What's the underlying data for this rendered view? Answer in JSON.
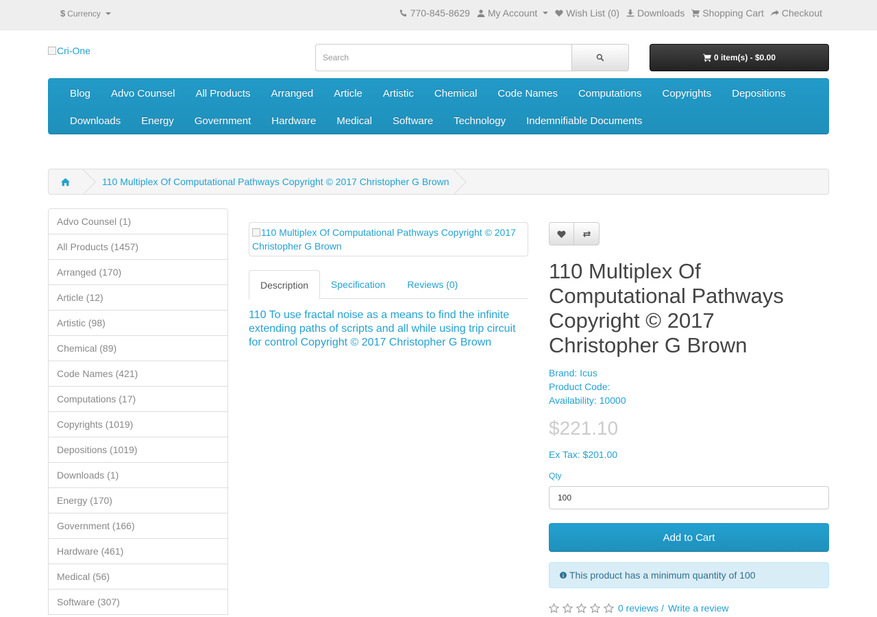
{
  "topbar": {
    "currency_symbol": "$",
    "currency_label": "Currency",
    "phone": "770-845-8629",
    "my_account": "My Account",
    "wishlist": "Wish List (0)",
    "downloads": "Downloads",
    "shopping_cart": "Shopping Cart",
    "checkout": "Checkout"
  },
  "header": {
    "logo_alt": "Cri-One",
    "search_placeholder": "Search",
    "cart_label": "0 item(s) - $0.00"
  },
  "menu": {
    "row1": [
      "Blog",
      "Advo Counsel",
      "All Products",
      "Arranged",
      "Article",
      "Artistic",
      "Chemical",
      "Code Names",
      "Computations",
      "Copyrights",
      "Depositions"
    ],
    "row2": [
      "Downloads",
      "Energy",
      "Government",
      "Hardware",
      "Medical",
      "Software",
      "Technology",
      "Indemnifiable Documents"
    ]
  },
  "breadcrumb": {
    "item": "110 Multiplex Of Computational Pathways Copyright © 2017 Christopher G Brown"
  },
  "sidebar": {
    "categories": [
      "Advo Counsel (1)",
      "All Products (1457)",
      "Arranged (170)",
      "Article (12)",
      "Artistic (98)",
      "Chemical (89)",
      "Code Names (421)",
      "Computations (17)",
      "Copyrights (1019)",
      "Depositions (1019)",
      "Downloads (1)",
      "Energy (170)",
      "Government (166)",
      "Hardware (461)",
      "Medical (56)",
      "Software (307)"
    ]
  },
  "product": {
    "image_alt": "110 Multiplex Of Computational Pathways Copyright © 2017 Christopher G Brown",
    "title": "110 Multiplex Of Computational Pathways Copyright © 2017 Christopher G Brown",
    "tabs": [
      "Description",
      "Specification",
      "Reviews (0)"
    ],
    "description": "110 To use fractal noise as a means to find the infinite extending paths of scripts and all while using trip circuit for control Copyright © 2017 Christopher G Brown",
    "brand_label": "Brand:",
    "brand_value": "Icus",
    "product_code_label": "Product Code:",
    "availability_label": "Availability:",
    "availability_value": "10000",
    "price": "$221.10",
    "ex_tax": "Ex Tax: $201.00",
    "qty_label": "Qty",
    "qty_value": "100",
    "add_to_cart": "Add to Cart",
    "min_qty_notice": "This product has a minimum quantity of 100",
    "reviews_link": "0 reviews",
    "review_sep": "/",
    "write_review": "Write a review",
    "rating_stars": 0
  },
  "colors": {
    "accent": "#23a1d1",
    "menu": "#229ac8",
    "cart_button": "#333333",
    "alert_bg": "#d9edf7"
  }
}
